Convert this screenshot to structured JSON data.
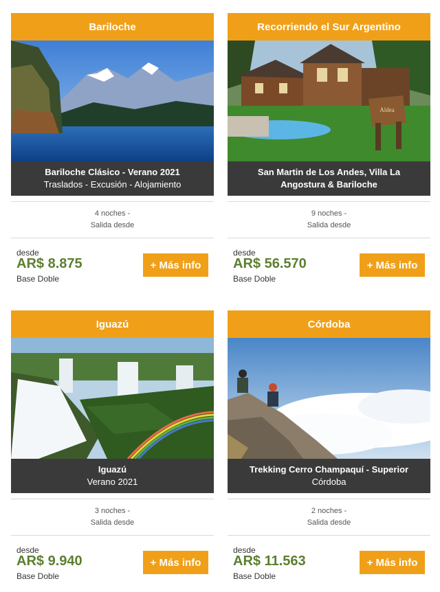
{
  "cards": [
    {
      "region": "Bariloche",
      "image_alt": "Lake and snowy mountains",
      "title": "Bariloche Clásico - Verano 2021",
      "subtitle": "Traslados - Excusión - Alojamiento",
      "nights": "4 noches -",
      "departure": "Salida desde",
      "desde": "desde",
      "price": "AR$ 8.875",
      "base": "Base Doble",
      "button": "+ Más info"
    },
    {
      "region": "Recorriendo el Sur Argentino",
      "image_alt": "Wooden lodge with pool",
      "title": "San Martin de Los Andes, Villa La",
      "subtitle": "Angostura & Bariloche",
      "nights": "9 noches -",
      "departure": "Salida desde",
      "desde": "desde",
      "price": "AR$ 56.570",
      "base": "Base Doble",
      "button": "+ Más info"
    },
    {
      "region": "Iguazú",
      "image_alt": "Iguazu waterfalls with rainbow",
      "title": "Iguazú",
      "subtitle": "Verano 2021",
      "nights": "3 noches -",
      "departure": "Salida desde",
      "desde": "desde",
      "price": "AR$ 9.940",
      "base": "Base Doble",
      "button": "+ Más info"
    },
    {
      "region": "Córdoba",
      "image_alt": "Hikers on rocky peak above clouds",
      "title": "Trekking Cerro Champaquí - Superior",
      "subtitle": "Córdoba",
      "nights": "2 noches -",
      "departure": "Salida desde",
      "desde": "desde",
      "price": "AR$ 11.563",
      "base": "Base Doble",
      "button": "+ Más info"
    }
  ],
  "colors": {
    "accent": "#f0a018",
    "price": "#5b7f2f",
    "caption_bg": "#3a3a3a"
  }
}
